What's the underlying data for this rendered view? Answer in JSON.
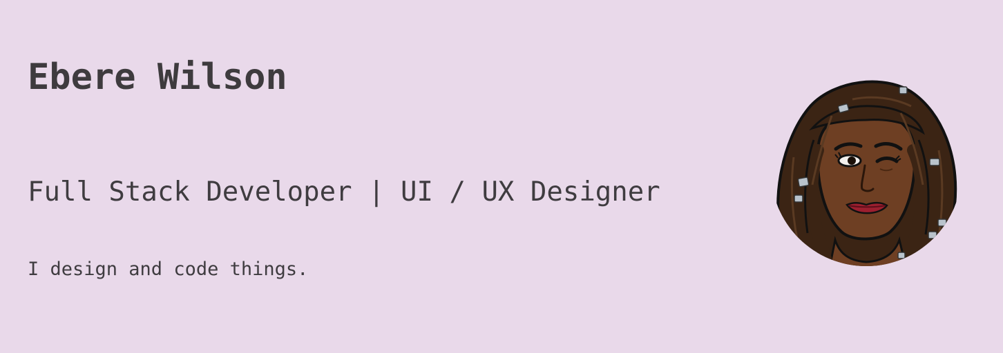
{
  "profile": {
    "name": "Ebere Wilson",
    "role": "Full Stack Developer | UI / UX Designer",
    "tagline": "I design and code things."
  },
  "avatar": {
    "icon": "bitmoji-avatar",
    "skin_color": "#6e3f23",
    "hair_color": "#3b2414",
    "lip_color": "#9c1f2f",
    "bead_color": "#b9c3cc"
  },
  "colors": {
    "background": "#e9d9ea",
    "text": "#3f3c40"
  }
}
